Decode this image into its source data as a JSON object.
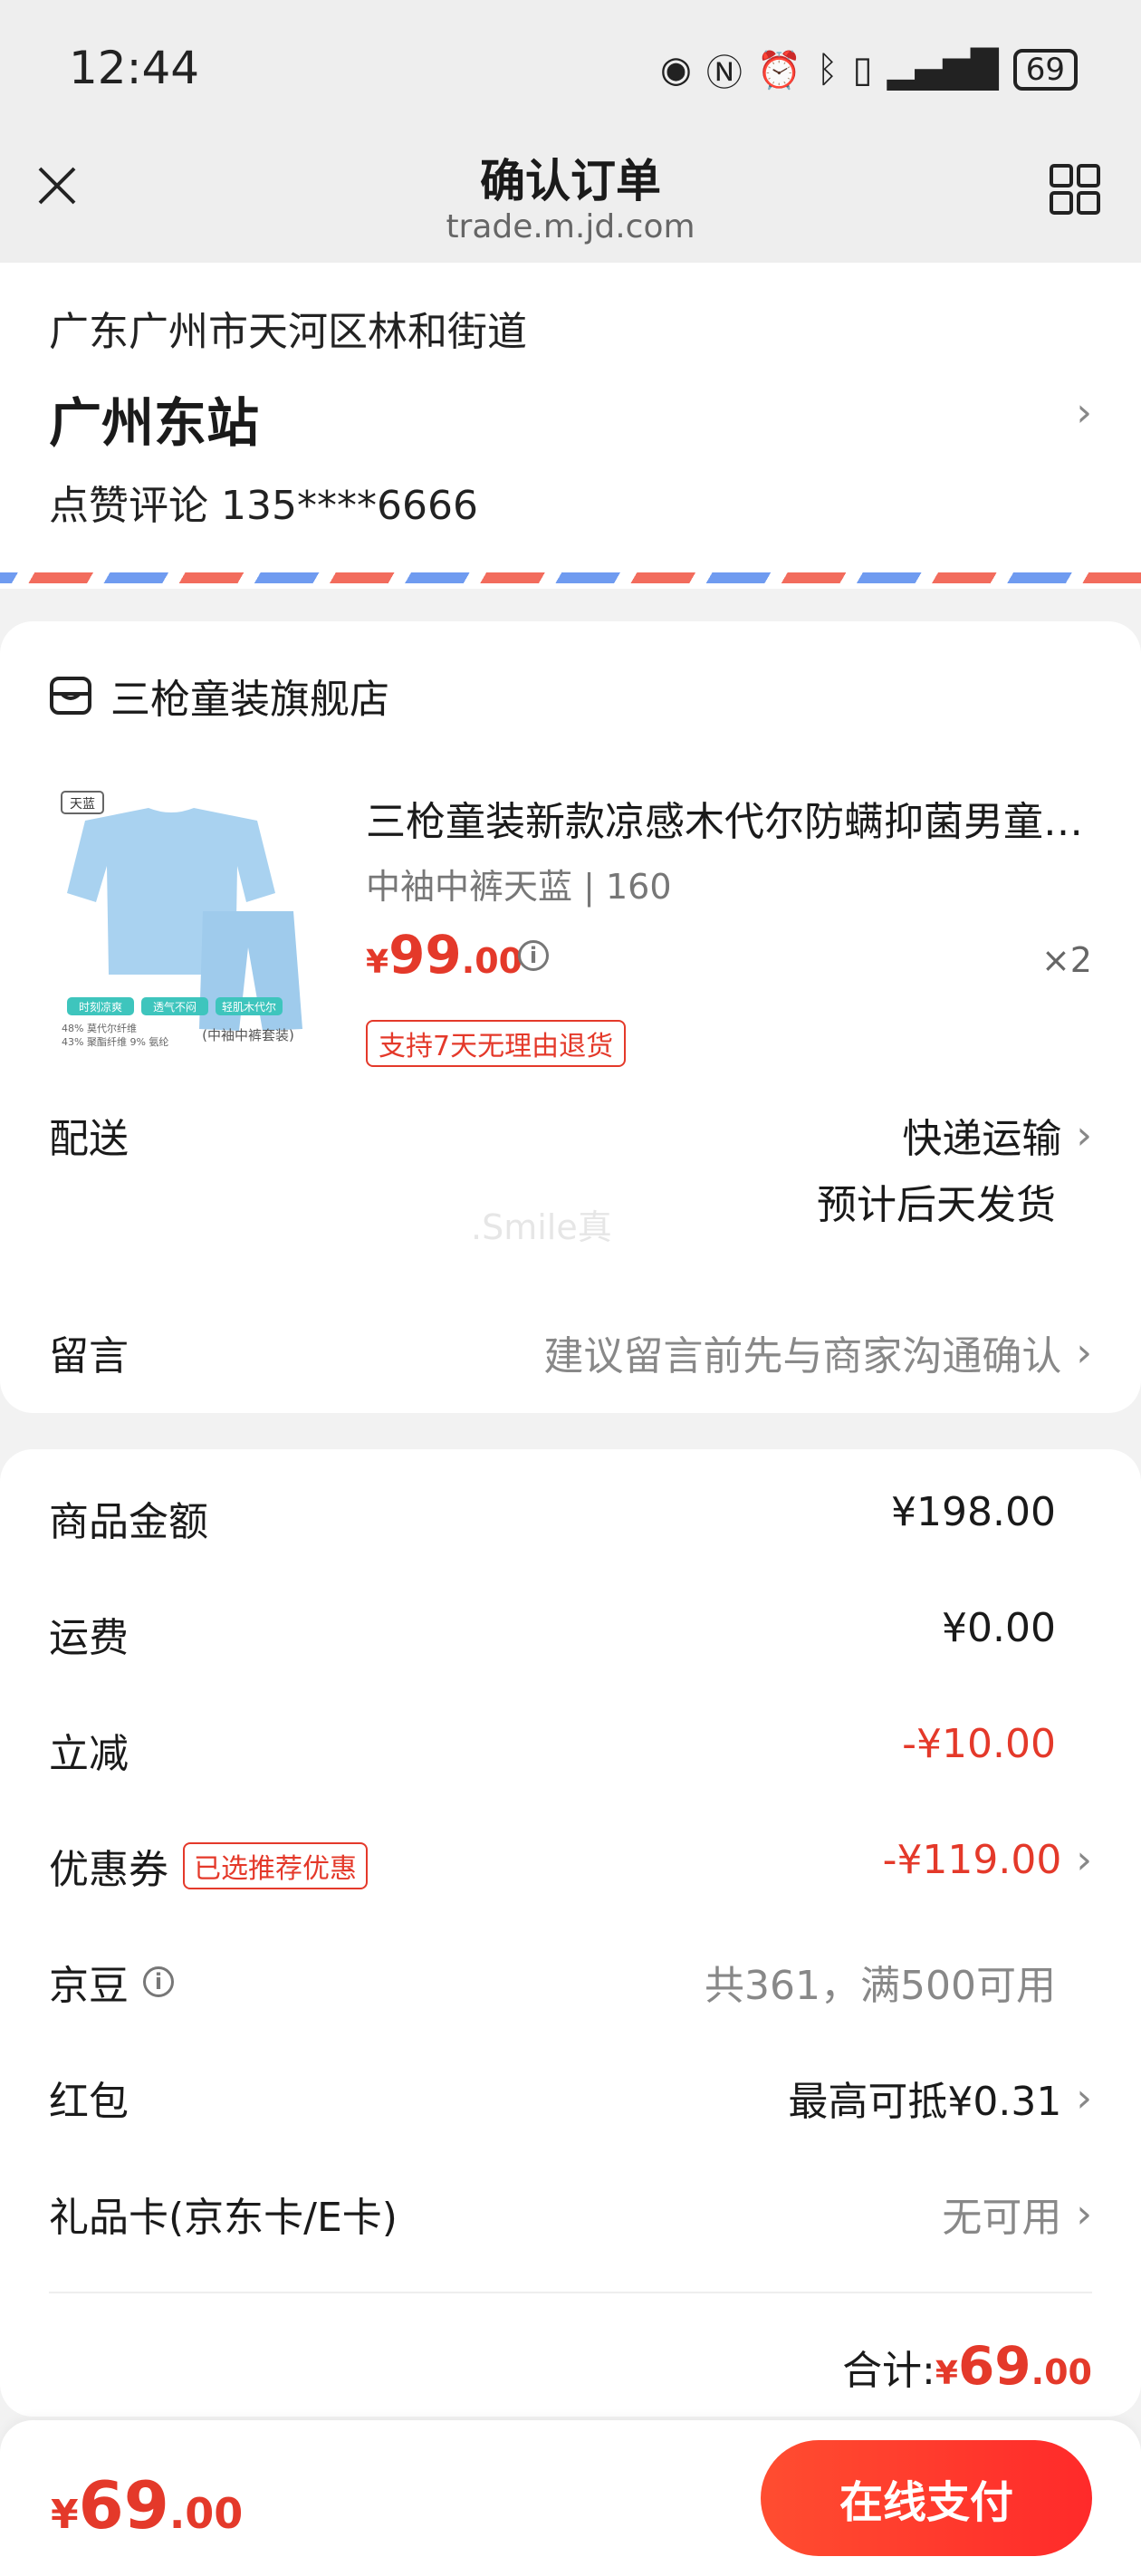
{
  "status_bar": {
    "time": "12:44",
    "battery": "69"
  },
  "nav": {
    "title": "确认订单",
    "url": "trade.m.jd.com"
  },
  "address": {
    "region": "广东广州市天河区林和街道",
    "name": "广州东站",
    "contact": "点赞评论  135****6666"
  },
  "shop": {
    "name": "三枪童装旗舰店"
  },
  "product": {
    "title": "三枪童装新款凉感木代尔防螨抑菌男童女童家居服套装",
    "spec": "中袖中裤天蓝 | 160",
    "price_currency": "¥",
    "price_int": "99",
    "price_dec": ".00",
    "qty": "×2",
    "return_tag": "支持7天无理由退货",
    "image_labels": {
      "badge": "天蓝",
      "feature1": "时刻凉爽",
      "feature2": "透气不闷",
      "feature3": "轻肌木代尔",
      "fabric1": "48% 莫代尔纤维",
      "fabric2": "43% 聚酯纤维 9% 氨纶",
      "caption": "(中袖中裤套装)"
    }
  },
  "delivery": {
    "label": "配送",
    "method": "快递运输",
    "eta": "预计后天发货"
  },
  "message": {
    "label": "留言",
    "placeholder": "建议留言前先与商家沟通确认"
  },
  "watermark": ".Smile真",
  "summary": {
    "goods_label": "商品金额",
    "goods_value": "¥198.00",
    "shipping_label": "运费",
    "shipping_value": "¥0.00",
    "discount_label": "立减",
    "discount_value": "-¥10.00",
    "coupon_label": "优惠券",
    "coupon_badge": "已选推荐优惠",
    "coupon_value": "-¥119.00",
    "jd_beans_label": "京豆",
    "jd_beans_value": "共361，满500可用",
    "redpacket_label": "红包",
    "redpacket_value": "最高可抵¥0.31",
    "giftcard_label": "礼品卡(京东卡/E卡)",
    "giftcard_value": "无可用",
    "total_label": "合计:",
    "total_currency": "¥",
    "total_int": "69",
    "total_dec": ".00"
  },
  "bottom": {
    "price_currency": "¥",
    "price_int": "69",
    "price_dec": ".00",
    "pay_label": "在线支付"
  },
  "colors": {
    "accent": "#e4392a",
    "pay_button": "#ff3b2a"
  }
}
